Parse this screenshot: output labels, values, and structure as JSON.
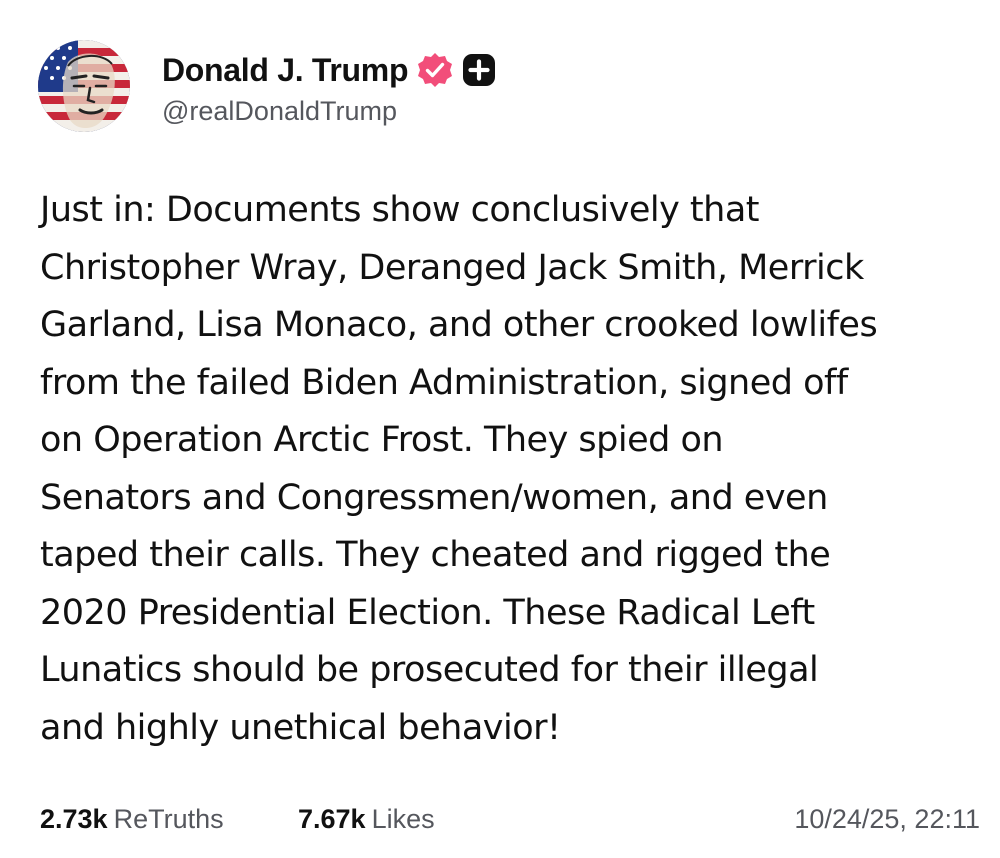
{
  "author": {
    "display_name": "Donald J. Trump",
    "handle": "@realDonaldTrump",
    "avatar_icon": "flag-portrait-avatar",
    "verified_icon": "verified-badge-icon",
    "verified_color": "#f24e7a",
    "extra_badge_icon": "plus-badge-icon"
  },
  "post": {
    "text": "Just in: Documents show conclusively that\nChristopher Wray, Deranged Jack Smith, Merrick\nGarland, Lisa Monaco, and other crooked lowlifes\nfrom the failed Biden Administration, signed off\non Operation Arctic Frost. They spied on\nSenators and Congressmen/women, and even\ntaped their calls. They cheated and rigged the\n2020 Presidential Election. These Radical Left\nLunatics should be prosecuted for their illegal\nand highly unethical behavior!"
  },
  "stats": {
    "retruths_count": "2.73k",
    "retruths_label": "ReTruths",
    "likes_count": "7.67k",
    "likes_label": "Likes",
    "timestamp": "10/24/25, 22:11"
  },
  "colors": {
    "text": "#111111",
    "secondary_text": "#55575d",
    "background": "#ffffff"
  }
}
